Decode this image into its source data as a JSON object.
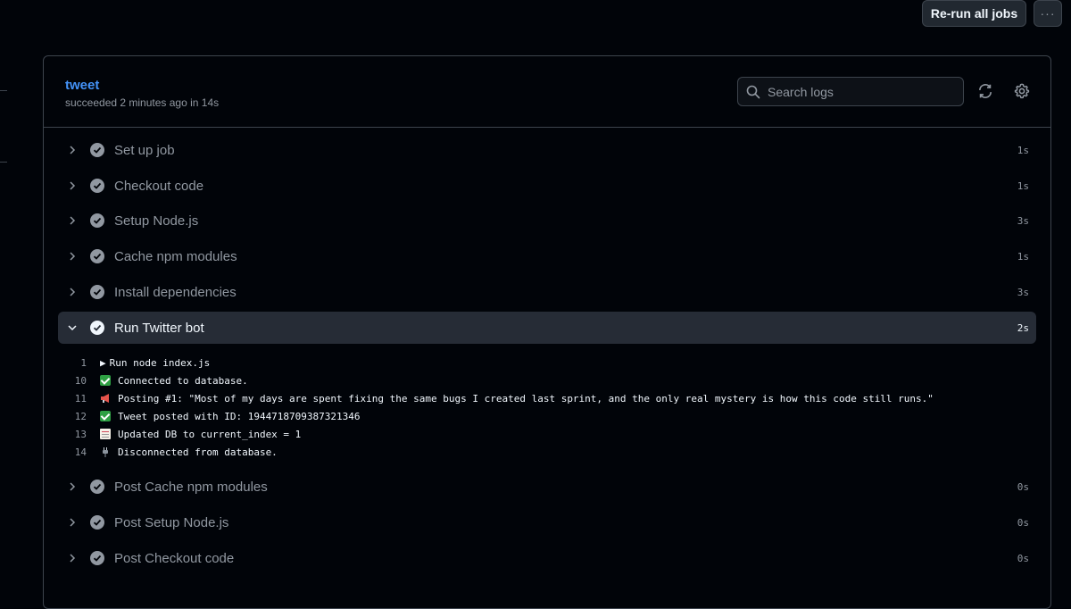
{
  "top_actions": {
    "rerun_label": "Re-run all jobs",
    "more_label": "···"
  },
  "job": {
    "title": "tweet",
    "subtitle": "succeeded 2 minutes ago in 14s"
  },
  "search": {
    "placeholder": "Search logs",
    "value": ""
  },
  "icons": {
    "refresh": "refresh-icon",
    "settings": "gear-icon",
    "search": "search-icon",
    "check": "check-circle-icon"
  },
  "colors": {
    "background": "#010409",
    "border": "#3d444d",
    "link": "#4493f8",
    "muted": "#9198a1",
    "active_row": "#262c36"
  },
  "steps_before": [
    {
      "label": "Set up job",
      "duration": "1s"
    },
    {
      "label": "Checkout code",
      "duration": "1s"
    },
    {
      "label": "Setup Node.js",
      "duration": "3s"
    },
    {
      "label": "Cache npm modules",
      "duration": "1s"
    },
    {
      "label": "Install dependencies",
      "duration": "3s"
    }
  ],
  "active_step": {
    "label": "Run Twitter bot",
    "duration": "2s",
    "expanded": true
  },
  "log_lines": [
    {
      "num": "1",
      "prefix": "▶",
      "text": "Run node index.js"
    },
    {
      "num": "10",
      "emoji": "check-mark-button",
      "text": "Connected to database."
    },
    {
      "num": "11",
      "emoji": "megaphone",
      "text": "Posting #1: \"Most of my days are spent fixing the same bugs I created last sprint, and the only real mystery is how this code still runs.\""
    },
    {
      "num": "12",
      "emoji": "check-mark-button",
      "text": "Tweet posted with ID: 1944718709387321346"
    },
    {
      "num": "13",
      "emoji": "memo",
      "text": "Updated DB to current_index = 1"
    },
    {
      "num": "14",
      "emoji": "electric-plug",
      "text": "Disconnected from database."
    }
  ],
  "steps_after": [
    {
      "label": "Post Cache npm modules",
      "duration": "0s"
    },
    {
      "label": "Post Setup Node.js",
      "duration": "0s"
    },
    {
      "label": "Post Checkout code",
      "duration": "0s"
    }
  ]
}
